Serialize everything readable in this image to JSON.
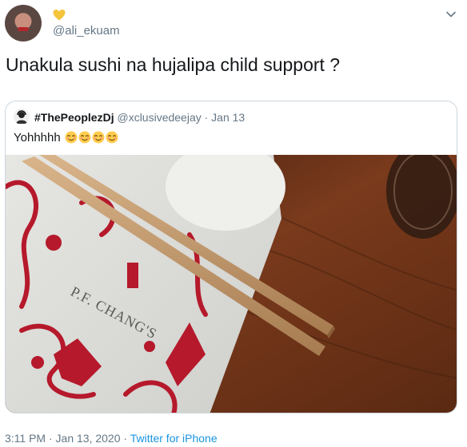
{
  "tweet": {
    "handle": "@ali_ekuam",
    "heart_icon": "yellow-heart-icon",
    "heart_color": "#f5c43b",
    "text": "Unakula sushi na hujalipa child support ?"
  },
  "quoted_tweet": {
    "display_name": "#ThePeoplezDj",
    "meta": "@xclusivedeejay · Jan 13",
    "text": "Yohhhhh",
    "emoji_icon": "relieved-face-emoji",
    "emoji_count": 4,
    "image": {
      "subject": "chopsticks-on-plate-photo",
      "plate_brand_text": "P.F. CHANG'S"
    }
  },
  "footer": {
    "timestamp": "3:11 PM · Jan 13, 2020 · ",
    "source": "Twitter for iPhone"
  },
  "colors": {
    "text_primary": "#14171a",
    "text_secondary": "#657786",
    "link": "#1b95e0",
    "border": "#ccd6dd"
  }
}
